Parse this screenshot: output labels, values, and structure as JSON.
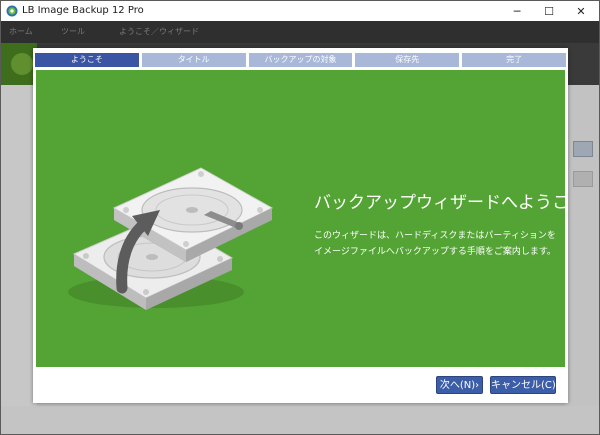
{
  "window": {
    "title": "LB Image Backup 12 Pro",
    "controls": {
      "minimize": "─",
      "maximize": "☐",
      "close": "✕"
    }
  },
  "background_app": {
    "tabs": [
      "ホーム",
      "ツール",
      "ようこそ／ウィザード"
    ]
  },
  "wizard": {
    "steps": [
      {
        "label": "ようこそ",
        "active": true
      },
      {
        "label": "タイトル",
        "active": false
      },
      {
        "label": "バックアップの対象",
        "active": false
      },
      {
        "label": "保存先",
        "active": false
      },
      {
        "label": "完了",
        "active": false
      }
    ],
    "heading": "バックアップウィザードへようこそ",
    "description": "このウィザードは、ハードディスクまたはパーティションをイメージファイルへバックアップする手順をご案内します。",
    "buttons": {
      "next": "次へ(N)›",
      "cancel": "キャンセル(C)"
    }
  },
  "colors": {
    "accent_green": "#54a435",
    "step_active": "#3a55a4",
    "step_inactive": "#a9b8d9",
    "button_blue": "#3c5da8"
  },
  "icons": {
    "app": "lb-app-icon",
    "hero": "hard-disk-backup-illustration"
  }
}
